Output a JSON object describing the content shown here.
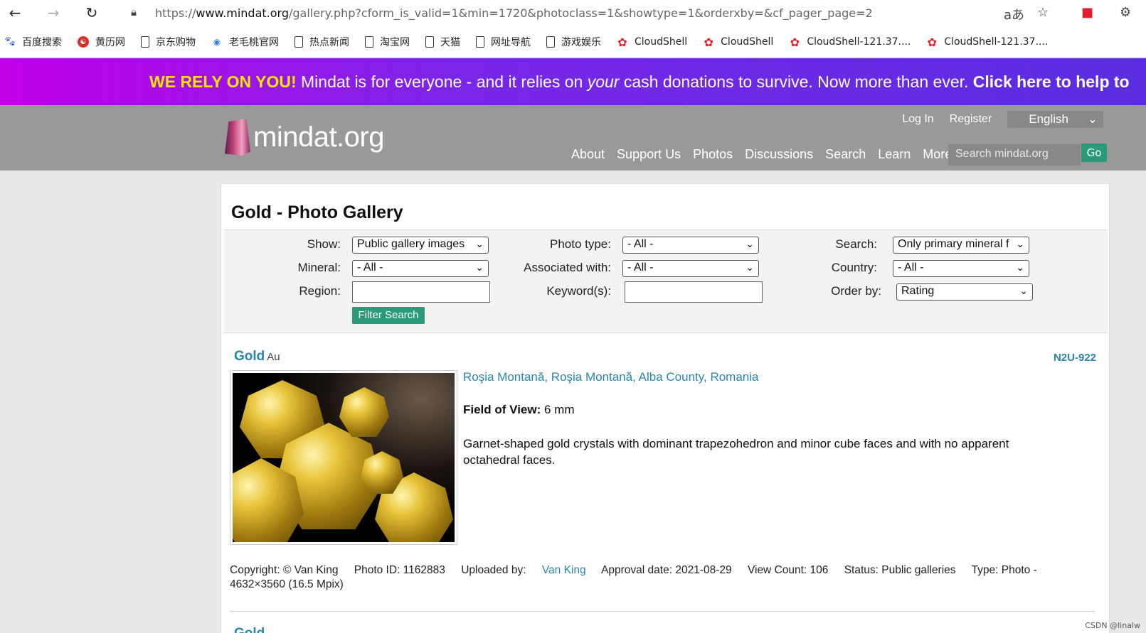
{
  "browser": {
    "url_prefix": "https://",
    "url_host": "www.mindat.org",
    "url_path": "/gallery.php?cform_is_valid=1&min=1720&photoclass=1&showtype=1&orderxby=&cf_pager_page=2",
    "bookmarks": [
      "百度搜索",
      "黄历网",
      "京东购物",
      "老毛桃官网",
      "热点新闻",
      "淘宝网",
      "天猫",
      "网址导航",
      "游戏娱乐",
      "CloudShell",
      "CloudShell",
      "CloudShell-121.37....",
      "CloudShell-121.37...."
    ]
  },
  "banner": {
    "rely": "WE RELY ON YOU!",
    "text_a": " Mindat is for everyone - and it relies on ",
    "text_your": "your",
    "text_b": " cash donations to survive. Now more than ever. ",
    "cta": "Click here to help to"
  },
  "header": {
    "logo_text": "mindat.org",
    "login": "Log In",
    "register": "Register",
    "language": "English",
    "nav": [
      "About",
      "Support Us",
      "Photos",
      "Discussions",
      "Search",
      "Learn",
      "More"
    ],
    "search_placeholder": "Search mindat.org",
    "go_label": "Go"
  },
  "gallery": {
    "title": "Gold - Photo Gallery",
    "filters": {
      "show_label": "Show:",
      "show_value": "Public gallery images",
      "phototype_label": "Photo type:",
      "phototype_value": "- All -",
      "search_label": "Search:",
      "search_value": "Only primary mineral f",
      "mineral_label": "Mineral:",
      "mineral_value": "- All -",
      "assoc_label": "Associated with:",
      "assoc_value": "- All -",
      "country_label": "Country:",
      "country_value": "- All -",
      "region_label": "Region:",
      "keyword_label": "Keyword(s):",
      "order_label": "Order by:",
      "order_value": "Rating",
      "filter_button": "Filter Search"
    },
    "entry": {
      "mineral": "Gold",
      "formula": "Au",
      "code": "N2U-922",
      "locality": "Roşia Montană, Roşia Montană, Alba County, Romania",
      "fov_label": "Field of View:",
      "fov_value": " 6 mm",
      "description": "Garnet-shaped gold crystals with dominant trapezohedron and minor cube faces and with no apparent octahedral faces.",
      "copyright": "Copyright: © Van King",
      "photo_id": "Photo ID: 1162883",
      "uploaded_label": "Uploaded by: ",
      "uploaded_by": "Van King",
      "approval": "Approval date: 2021-08-29",
      "view_count": "View Count: 106",
      "status": "Status: Public galleries",
      "type": "Type: Photo - 4632×3560 (16.5 Mpix)"
    },
    "next_entry": "Gold"
  },
  "watermark": "CSDN @linalw"
}
